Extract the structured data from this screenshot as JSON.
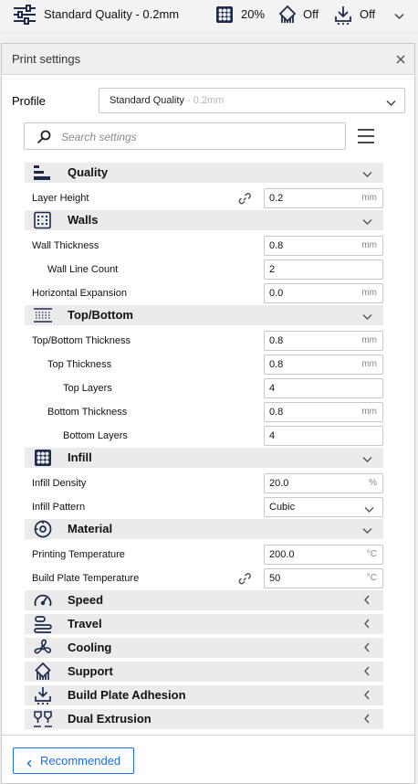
{
  "header": {
    "profile_summary": "Standard Quality - 0.2mm",
    "infill_value": "20%",
    "support_value": "Off",
    "adhesion_value": "Off",
    "icons": [
      "settings-sliders-icon",
      "infill-icon",
      "support-icon",
      "adhesion-icon",
      "chevron-down-icon"
    ]
  },
  "panel": {
    "title": "Print settings",
    "profile_label": "Profile",
    "profile_name": "Standard Quality",
    "profile_sub": " - 0.2mm",
    "search_placeholder": "Search settings",
    "categories": [
      {
        "label": "Quality",
        "icon": "quality-icon",
        "expanded": true,
        "settings": [
          {
            "label": "Layer Height",
            "value": "0.2",
            "unit": "mm",
            "level": 0,
            "linked": true
          }
        ]
      },
      {
        "label": "Walls",
        "icon": "walls-icon",
        "expanded": true,
        "settings": [
          {
            "label": "Wall Thickness",
            "value": "0.8",
            "unit": "mm",
            "level": 0
          },
          {
            "label": "Wall Line Count",
            "value": "2",
            "unit": "",
            "level": 1
          },
          {
            "label": "Horizontal Expansion",
            "value": "0.0",
            "unit": "mm",
            "level": 0
          }
        ]
      },
      {
        "label": "Top/Bottom",
        "icon": "top-bottom-icon",
        "expanded": true,
        "settings": [
          {
            "label": "Top/Bottom Thickness",
            "value": "0.8",
            "unit": "mm",
            "level": 0
          },
          {
            "label": "Top Thickness",
            "value": "0.8",
            "unit": "mm",
            "level": 1
          },
          {
            "label": "Top Layers",
            "value": "4",
            "unit": "",
            "level": 2
          },
          {
            "label": "Bottom Thickness",
            "value": "0.8",
            "unit": "mm",
            "level": 1
          },
          {
            "label": "Bottom Layers",
            "value": "4",
            "unit": "",
            "level": 2
          }
        ]
      },
      {
        "label": "Infill",
        "icon": "infill-icon",
        "expanded": true,
        "settings": [
          {
            "label": "Infill Density",
            "value": "20.0",
            "unit": "%",
            "level": 0
          },
          {
            "label": "Infill Pattern",
            "value": "Cubic",
            "unit": "",
            "level": 0,
            "dropdown": true
          }
        ]
      },
      {
        "label": "Material",
        "icon": "material-icon",
        "expanded": true,
        "settings": [
          {
            "label": "Printing Temperature",
            "value": "200.0",
            "unit": "°C",
            "level": 0
          },
          {
            "label": "Build Plate Temperature",
            "value": "50",
            "unit": "°C",
            "level": 0,
            "linked": true
          }
        ]
      },
      {
        "label": "Speed",
        "icon": "speed-icon",
        "expanded": false,
        "settings": []
      },
      {
        "label": "Travel",
        "icon": "travel-icon",
        "expanded": false,
        "settings": []
      },
      {
        "label": "Cooling",
        "icon": "cooling-fan-icon",
        "expanded": false,
        "settings": []
      },
      {
        "label": "Support",
        "icon": "support-icon",
        "expanded": false,
        "settings": []
      },
      {
        "label": "Build Plate Adhesion",
        "icon": "adhesion-icon",
        "expanded": false,
        "settings": []
      },
      {
        "label": "Dual Extrusion",
        "icon": "dual-extrusion-icon",
        "expanded": false,
        "settings": []
      }
    ],
    "recommended_label": "Recommended"
  },
  "colors": {
    "accent": "#196ef0",
    "category_bg": "#ebebeb",
    "panel_header_bg": "#efefef"
  }
}
